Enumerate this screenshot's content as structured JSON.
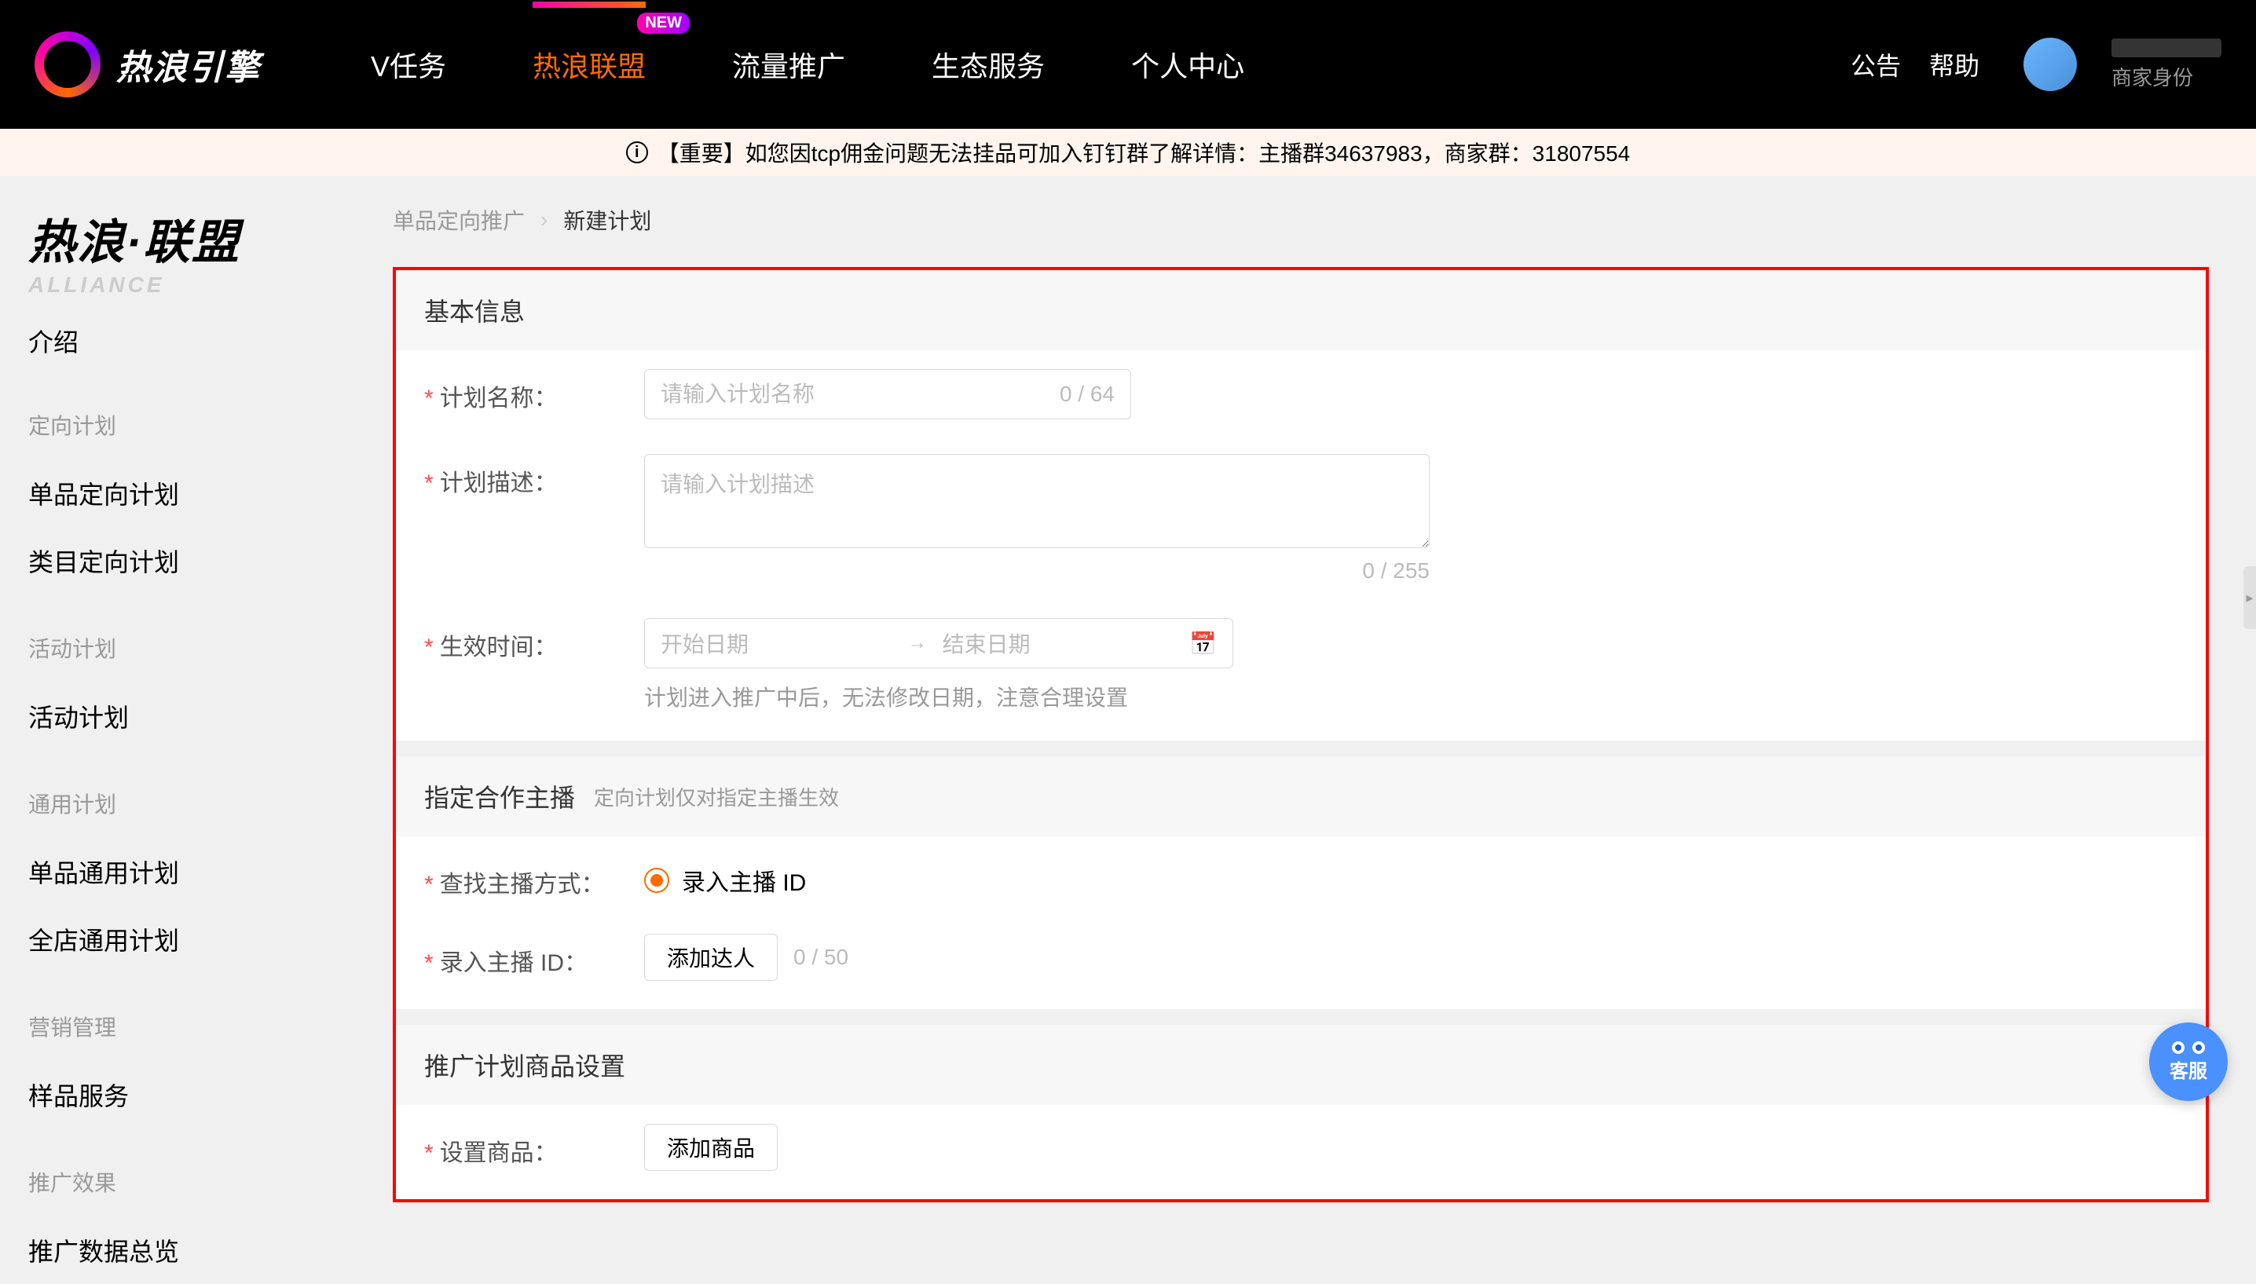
{
  "header": {
    "logo_text": "热浪引擎",
    "nav": [
      {
        "label": "V任务",
        "active": false
      },
      {
        "label": "热浪联盟",
        "active": true,
        "badge": "NEW"
      },
      {
        "label": "流量推广",
        "active": false
      },
      {
        "label": "生态服务",
        "active": false
      },
      {
        "label": "个人中心",
        "active": false
      }
    ],
    "right_links": [
      "公告",
      "帮助"
    ],
    "user_role": "商家身份"
  },
  "notice": {
    "text": "【重要】如您因tcp佣金问题无法挂品可加入钉钉群了解详情：主播群34637983，商家群：31807554"
  },
  "sidebar": {
    "title": "热浪·联盟",
    "subtitle": "ALLIANCE",
    "intro": "介绍",
    "groups": [
      {
        "header": "定向计划",
        "items": [
          "单品定向计划",
          "类目定向计划"
        ]
      },
      {
        "header": "活动计划",
        "items": [
          "活动计划"
        ]
      },
      {
        "header": "通用计划",
        "items": [
          "单品通用计划",
          "全店通用计划"
        ]
      },
      {
        "header": "营销管理",
        "items": [
          "样品服务"
        ]
      },
      {
        "header": "推广效果",
        "items": [
          "推广数据总览"
        ]
      }
    ]
  },
  "breadcrumb": {
    "parent": "单品定向推广",
    "current": "新建计划"
  },
  "form": {
    "section1": {
      "title": "基本信息",
      "name_label": "计划名称：",
      "name_placeholder": "请输入计划名称",
      "name_counter": "0 / 64",
      "desc_label": "计划描述：",
      "desc_placeholder": "请输入计划描述",
      "desc_counter": "0 / 255",
      "date_label": "生效时间：",
      "date_start_placeholder": "开始日期",
      "date_end_placeholder": "结束日期",
      "date_hint": "计划进入推广中后，无法修改日期，注意合理设置"
    },
    "section2": {
      "title": "指定合作主播",
      "hint": "定向计划仅对指定主播生效",
      "find_label": "查找主播方式：",
      "radio_label": "录入主播 ID",
      "id_label": "录入主播 ID：",
      "btn_add_anchor": "添加达人",
      "id_counter": "0 / 50"
    },
    "section3": {
      "title": "推广计划商品设置",
      "product_label": "设置商品：",
      "btn_add_product": "添加商品"
    }
  },
  "cs_label": "客服"
}
